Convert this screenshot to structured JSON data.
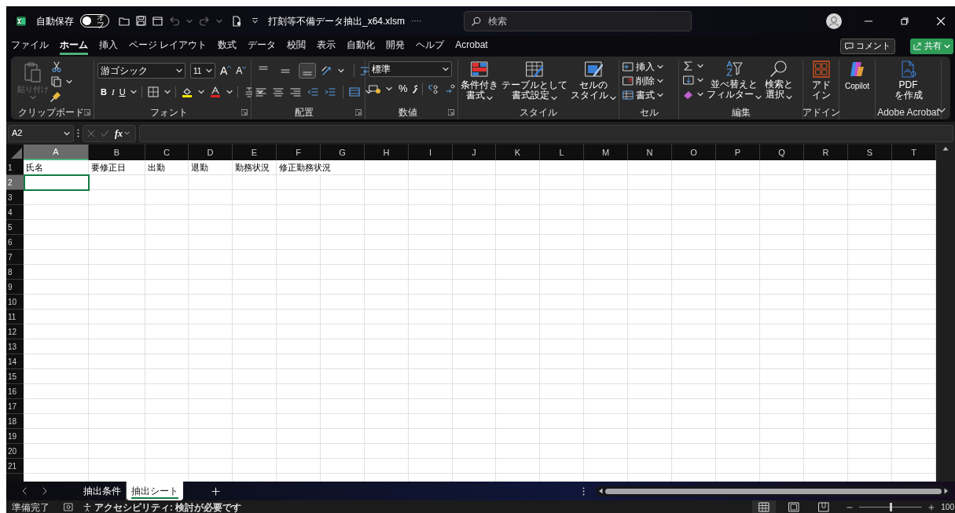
{
  "title_bar": {
    "autosave_label": "自動保存",
    "autosave_toggle": {
      "label": "オフ",
      "on": false
    },
    "filename": "打刻等不備データ抽出_x64.xlsm",
    "more": "····",
    "search_placeholder": "検索"
  },
  "menu_tabs": [
    {
      "label": "ファイル",
      "selected": false
    },
    {
      "label": "ホーム",
      "selected": true
    },
    {
      "label": "挿入",
      "selected": false
    },
    {
      "label": "ページ レイアウト",
      "selected": false
    },
    {
      "label": "数式",
      "selected": false
    },
    {
      "label": "データ",
      "selected": false
    },
    {
      "label": "校閲",
      "selected": false
    },
    {
      "label": "表示",
      "selected": false
    },
    {
      "label": "自動化",
      "selected": false
    },
    {
      "label": "開発",
      "selected": false
    },
    {
      "label": "ヘルプ",
      "selected": false
    },
    {
      "label": "Acrobat",
      "selected": false
    }
  ],
  "actions": {
    "comment": "コメント",
    "share": "共有"
  },
  "ribbon": {
    "clipboard": {
      "label": "クリップボード",
      "paste": "貼り付け",
      "paste_disabled": true
    },
    "font": {
      "label": "フォント",
      "font_name": "游ゴシック",
      "font_size": "11",
      "grow": "A",
      "shrink": "A",
      "bold": "B",
      "italic": "I",
      "underline": "U"
    },
    "alignment": {
      "label": "配置",
      "vertical_align": [
        {
          "selected": false
        },
        {
          "selected": false
        },
        {
          "selected": true
        }
      ]
    },
    "number": {
      "label": "数値",
      "format": "標準",
      "percent": "%"
    },
    "styles": {
      "label": "スタイル",
      "buttons": [
        [
          "条件付き",
          "書式"
        ],
        [
          "テーブルとして",
          "書式設定"
        ],
        [
          "セルの",
          "スタイル"
        ]
      ]
    },
    "cells": {
      "label": "セル",
      "buttons": [
        "挿入",
        "削除",
        "書式"
      ]
    },
    "editing": {
      "label": "編集",
      "buttons": [
        [
          "並べ替えと",
          "フィルター"
        ],
        [
          "検索と",
          "選択"
        ]
      ]
    },
    "addins": {
      "label": "アドイン",
      "button": [
        "アド",
        "イン"
      ]
    },
    "copilot": {
      "button": "Copilot"
    },
    "acrobat": {
      "label": "Adobe Acrobat",
      "button": [
        "PDF",
        "を作成"
      ]
    }
  },
  "formula_bar": {
    "name_box": "A2",
    "function_button": "fx"
  },
  "columns": [
    {
      "label": "A",
      "selected": true
    },
    {
      "label": "B",
      "selected": false
    },
    {
      "label": "C",
      "selected": false
    },
    {
      "label": "D",
      "selected": false
    },
    {
      "label": "E",
      "selected": false
    },
    {
      "label": "F",
      "selected": false
    },
    {
      "label": "G",
      "selected": false
    },
    {
      "label": "H",
      "selected": false
    },
    {
      "label": "I",
      "selected": false
    },
    {
      "label": "J",
      "selected": false
    },
    {
      "label": "K",
      "selected": false
    },
    {
      "label": "L",
      "selected": false
    },
    {
      "label": "M",
      "selected": false
    },
    {
      "label": "N",
      "selected": false
    },
    {
      "label": "O",
      "selected": false
    },
    {
      "label": "P",
      "selected": false
    },
    {
      "label": "Q",
      "selected": false
    },
    {
      "label": "R",
      "selected": false
    },
    {
      "label": "S",
      "selected": false
    },
    {
      "label": "T",
      "selected": false
    }
  ],
  "rows": [
    {
      "header": "1",
      "selected": false,
      "cells": [
        "氏名",
        "要修正日",
        "出勤",
        "退勤",
        "勤務状況",
        "修正勤務状況"
      ]
    },
    {
      "header": "2",
      "selected": true
    },
    {
      "header": "3",
      "selected": false
    },
    {
      "header": "4",
      "selected": false
    },
    {
      "header": "5",
      "selected": false
    },
    {
      "header": "6",
      "selected": false
    },
    {
      "header": "7",
      "selected": false
    },
    {
      "header": "8",
      "selected": false
    },
    {
      "header": "9",
      "selected": false
    },
    {
      "header": "10",
      "selected": false
    },
    {
      "header": "11",
      "selected": false
    },
    {
      "header": "12",
      "selected": false
    },
    {
      "header": "13",
      "selected": false
    },
    {
      "header": "14",
      "selected": false
    },
    {
      "header": "15",
      "selected": false
    },
    {
      "header": "16",
      "selected": false
    },
    {
      "header": "17",
      "selected": false
    },
    {
      "header": "18",
      "selected": false
    },
    {
      "header": "19",
      "selected": false
    },
    {
      "header": "20",
      "selected": false
    },
    {
      "header": "21",
      "selected": false
    }
  ],
  "sheet_tabs": [
    {
      "label": "抽出条件",
      "selected": false
    },
    {
      "label": "抽出シート",
      "selected": true
    }
  ],
  "status_bar": {
    "ready": "準備完了",
    "accessibility": "アクセシビリティ: 検討が必要です",
    "views": [
      {
        "selected": true
      },
      {
        "selected": false
      },
      {
        "selected": false
      }
    ],
    "zoom": {
      "level": 0.5,
      "reading": "100"
    }
  }
}
